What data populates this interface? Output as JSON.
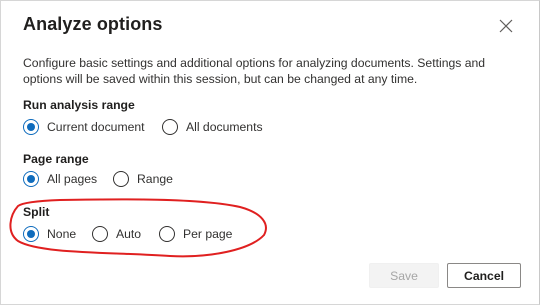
{
  "dialog": {
    "title": "Analyze options",
    "description": "Configure basic settings and additional options for analyzing documents. Settings and options will be saved within this session, but can be changed at any time."
  },
  "run_analysis_range": {
    "label": "Run analysis range",
    "options": [
      {
        "label": "Current document",
        "selected": true
      },
      {
        "label": "All documents",
        "selected": false
      }
    ]
  },
  "page_range": {
    "label": "Page range",
    "options": [
      {
        "label": "All pages",
        "selected": true
      },
      {
        "label": "Range",
        "selected": false
      }
    ]
  },
  "split": {
    "label": "Split",
    "options": [
      {
        "label": "None",
        "selected": true
      },
      {
        "label": "Auto",
        "selected": false
      },
      {
        "label": "Per page",
        "selected": false
      }
    ]
  },
  "buttons": {
    "save_label": "Save",
    "save_enabled": false,
    "cancel_label": "Cancel"
  },
  "colors": {
    "accent": "#0f6cbd",
    "annotation": "#e02020"
  },
  "icons": {
    "close": "close-icon"
  }
}
